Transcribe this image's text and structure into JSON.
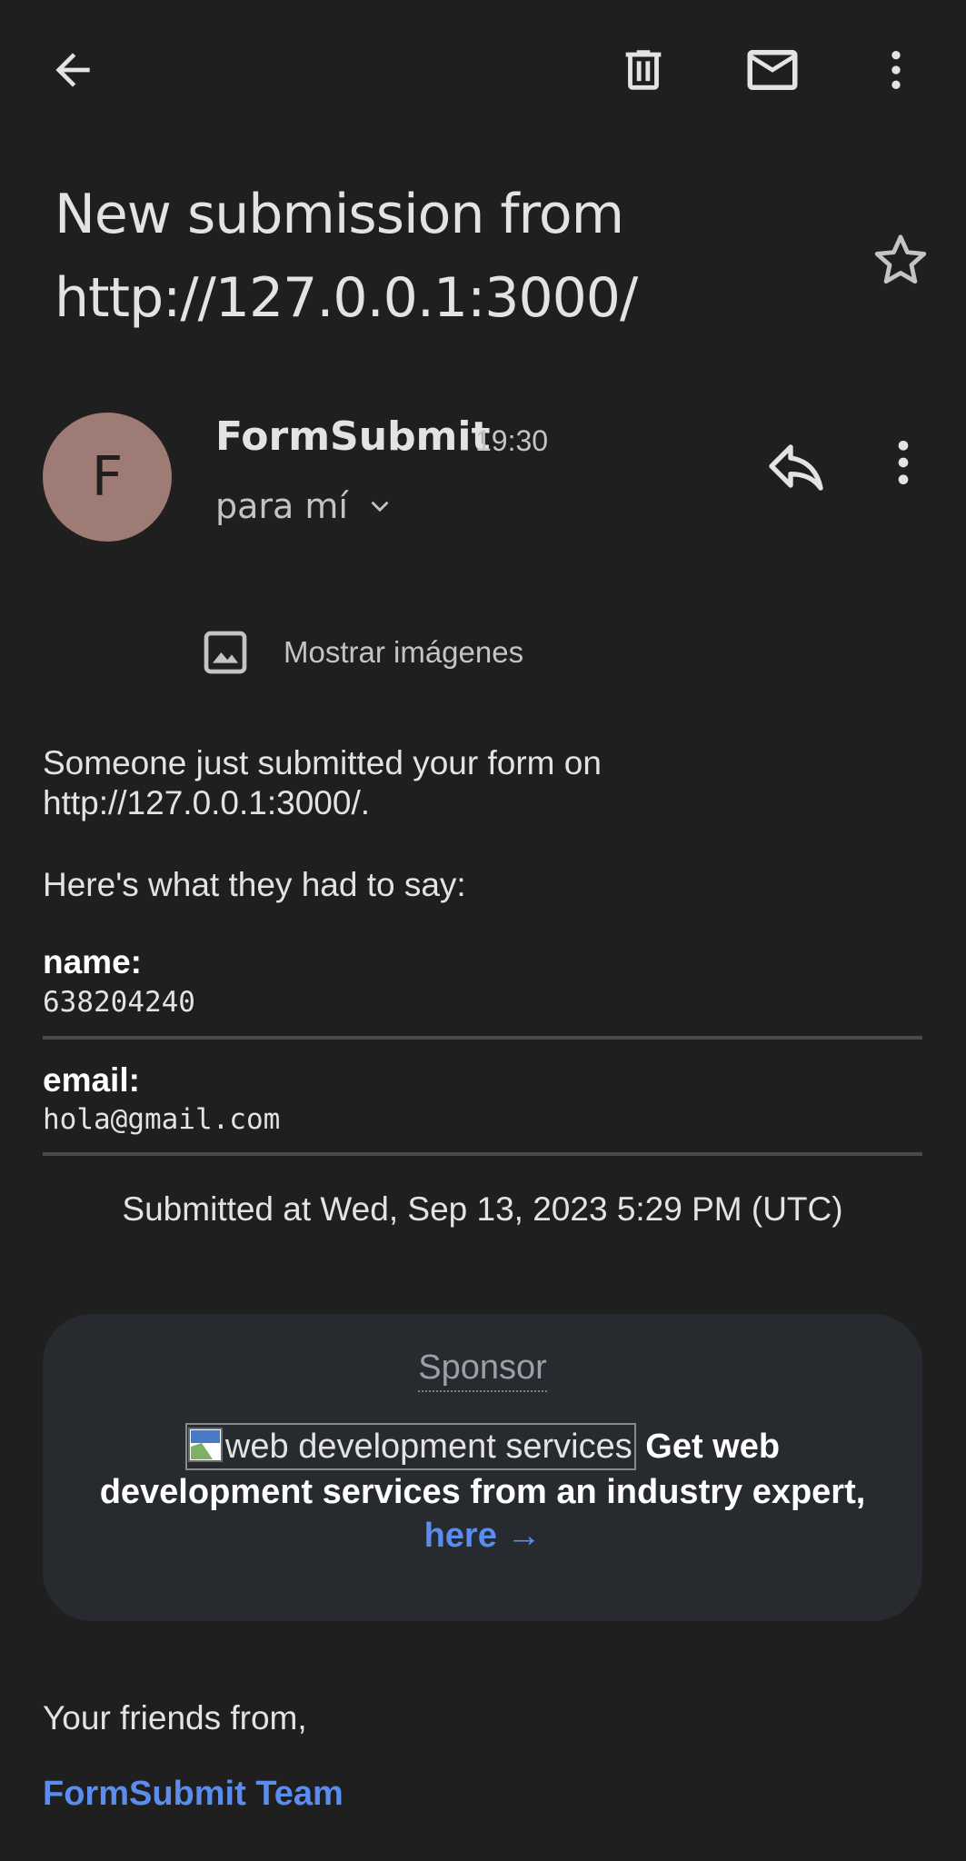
{
  "toolbar": {
    "back_icon": "arrow-back-icon",
    "delete_icon": "trash-icon",
    "mark_unread_icon": "mail-icon",
    "more_icon": "more-vert-icon"
  },
  "email": {
    "subject_line1": "New submission from",
    "subject_line2": "http://127.0.0.1:3000/",
    "sender_initial": "F",
    "sender_name": "FormSubmit",
    "time": "19:30",
    "recipient": "para mí",
    "show_images": "Mostrar imágenes"
  },
  "body": {
    "intro": "Someone just submitted your form on http://127.0.0.1:3000/.",
    "said": "Here's what they had to say:",
    "fields": [
      {
        "label": "name:",
        "value": "638204240"
      },
      {
        "label": "email:",
        "value": "hola@gmail.com"
      }
    ],
    "submitted": "Submitted at Wed, Sep 13, 2023 5:29 PM (UTC)"
  },
  "sponsor": {
    "title": "Sponsor",
    "image_alt": "web development services",
    "text": "Get web development services from an industry expert,",
    "link": "here →"
  },
  "footer": {
    "signoff": "Your friends from,",
    "team": "FormSubmit Team"
  },
  "colors": {
    "background": "#1f1f1f",
    "avatar": "#9e7b74",
    "link": "#5b8def",
    "card": "#272a2e"
  }
}
